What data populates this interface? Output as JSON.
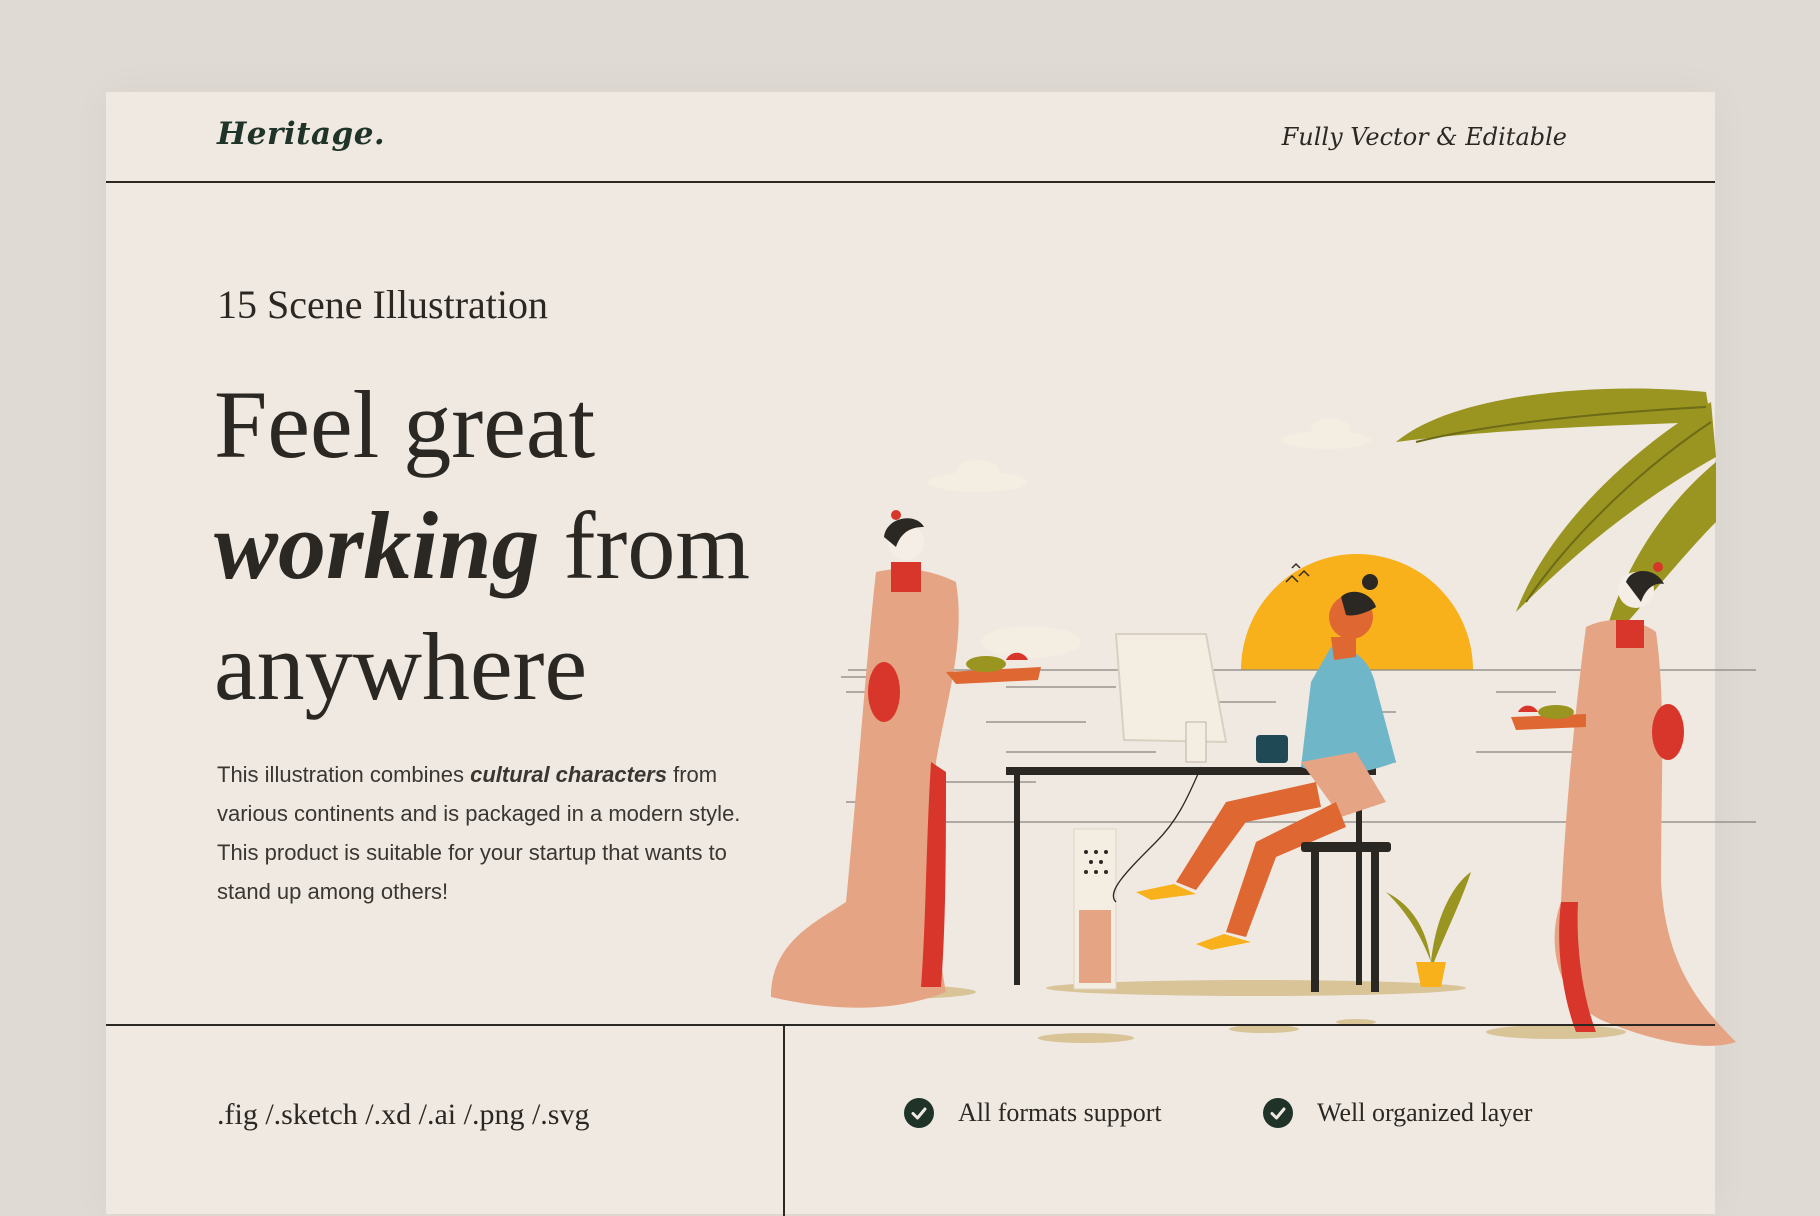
{
  "header": {
    "logo": "Heritage.",
    "tagline": "Fully Vector & Editable"
  },
  "hero": {
    "scene_count": "15 Scene Illustration",
    "headline_line1": "Feel great",
    "headline_italic": "working",
    "headline_line2_rest": " from",
    "headline_line3": "anywhere",
    "description_before": "This illustration combines ",
    "description_bold": "cultural characters",
    "description_after": " from various continents and is packaged in a modern style. This product is suitable for your startup that wants to stand up among others!"
  },
  "footer": {
    "formats": ".fig /.sketch /.xd /.ai /.png /.svg",
    "features": [
      "All formats support",
      "Well organized layer"
    ]
  },
  "colors": {
    "background": "#e0dad4",
    "card": "#efe9e2",
    "logo": "#1f3328",
    "check": "#1f3328",
    "sun": "#f8b01b",
    "leaf": "#9a9520",
    "robe": "#e5a584",
    "accent_red": "#d8362b",
    "shirt": "#70b6c9",
    "skin": "#df6731"
  },
  "icons": [
    "check-icon",
    "illustration"
  ]
}
